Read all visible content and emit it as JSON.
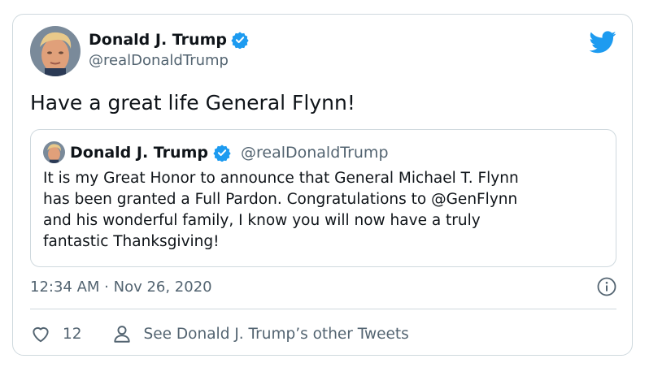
{
  "author": {
    "name": "Donald J. Trump",
    "handle": "@realDonaldTrump",
    "verified": true
  },
  "tweet": {
    "text": "Have a great life General Flynn!",
    "timestamp": "12:34 AM · Nov 26, 2020"
  },
  "quoted_tweet": {
    "name": "Donald J. Trump",
    "handle": "@realDonaldTrump",
    "verified": true,
    "lines": [
      "It is my Great Honor to announce that General Michael T. Flynn",
      "has been granted a Full Pardon. Congratulations to @GenFlynn",
      "and his wonderful family, I know you will now have a truly",
      "fantastic Thanksgiving!"
    ]
  },
  "actions": {
    "like_count": "12",
    "see_more_label": "See Donald J. Trump’s other Tweets"
  },
  "icons": {
    "brand": "twitter-bird-icon",
    "verified": "verified-badge-icon",
    "info": "info-icon",
    "like": "heart-icon",
    "profile": "person-icon"
  },
  "colors": {
    "brand_blue": "#1d9bf0",
    "text_primary": "#0f1419",
    "text_secondary": "#536471",
    "border": "#cfd9de"
  }
}
